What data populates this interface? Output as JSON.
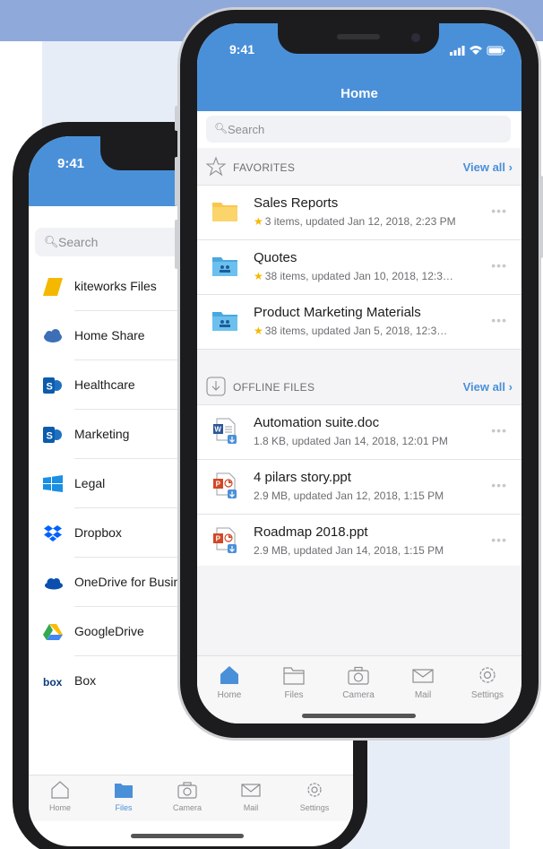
{
  "colors": {
    "accent": "#4a90d9",
    "star": "#f5b800",
    "background_band": "#8fa9db"
  },
  "back_phone": {
    "status_time": "9:41",
    "search": {
      "placeholder": "Search"
    },
    "sources": [
      {
        "label": "kiteworks Files",
        "icon": "kiteworks-icon"
      },
      {
        "label": "Home Share",
        "icon": "cloud-share-icon"
      },
      {
        "label": "Healthcare",
        "icon": "sharepoint-icon"
      },
      {
        "label": "Marketing",
        "icon": "sharepoint-icon"
      },
      {
        "label": "Legal",
        "icon": "windows-icon"
      },
      {
        "label": "Dropbox",
        "icon": "dropbox-icon"
      },
      {
        "label": "OneDrive for Business",
        "icon": "onedrive-icon"
      },
      {
        "label": "GoogleDrive",
        "icon": "googledrive-icon"
      },
      {
        "label": "Box",
        "icon": "box-icon"
      }
    ],
    "tabs": [
      {
        "label": "Home",
        "icon": "home-icon",
        "active": false
      },
      {
        "label": "Files",
        "icon": "folder-icon",
        "active": true
      },
      {
        "label": "Camera",
        "icon": "camera-icon",
        "active": false
      },
      {
        "label": "Mail",
        "icon": "mail-icon",
        "active": false
      },
      {
        "label": "Settings",
        "icon": "gear-icon",
        "active": false
      }
    ]
  },
  "front_phone": {
    "status_time": "9:41",
    "title": "Home",
    "search": {
      "placeholder": "Search"
    },
    "favorites": {
      "title": "FAVORITES",
      "view_all": "View all",
      "items": [
        {
          "name": "Sales Reports",
          "meta": "3 items, updated Jan 12, 2018, 2:23 PM",
          "icon": "folder-icon"
        },
        {
          "name": "Quotes",
          "meta": "38 items, updated Jan 10, 2018, 12:3…",
          "icon": "shared-folder-icon"
        },
        {
          "name": "Product Marketing Materials",
          "meta": "38 items, updated Jan 5, 2018, 12:3…",
          "icon": "shared-folder-icon"
        }
      ]
    },
    "offline": {
      "title": "OFFLINE FILES",
      "view_all": "View all",
      "items": [
        {
          "name": "Automation suite.doc",
          "meta": "1.8 KB, updated Jan 14, 2018, 12:01 PM",
          "icon": "word-doc-icon"
        },
        {
          "name": "4 pilars story.ppt",
          "meta": "2.9 MB, updated Jan 12, 2018, 1:15 PM",
          "icon": "powerpoint-icon"
        },
        {
          "name": "Roadmap 2018.ppt",
          "meta": "2.9 MB, updated Jan 14, 2018, 1:15 PM",
          "icon": "powerpoint-icon"
        }
      ]
    },
    "more_glyph": "•••",
    "tabs": [
      {
        "label": "Home",
        "icon": "home-icon",
        "active": true
      },
      {
        "label": "Files",
        "icon": "folder-icon",
        "active": false
      },
      {
        "label": "Camera",
        "icon": "camera-icon",
        "active": false
      },
      {
        "label": "Mail",
        "icon": "mail-icon",
        "active": false
      },
      {
        "label": "Settings",
        "icon": "gear-icon",
        "active": false
      }
    ]
  }
}
